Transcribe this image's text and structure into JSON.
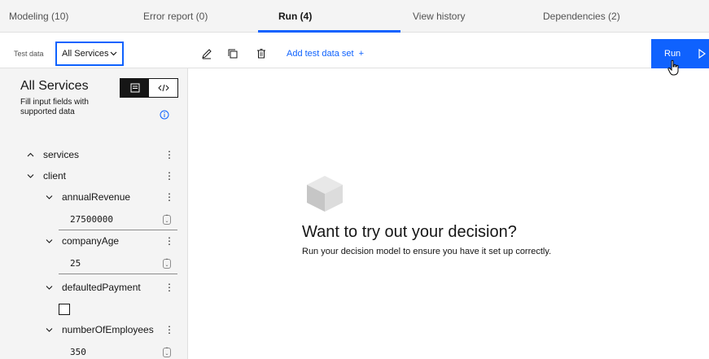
{
  "tabs": [
    {
      "label": "Modeling (10)"
    },
    {
      "label": "Error report (0)"
    },
    {
      "label": "Run (4)"
    },
    {
      "label": "View history"
    },
    {
      "label": "Dependencies (2)"
    }
  ],
  "active_tab": "Run (4)",
  "toolbar": {
    "test_data_label": "Test data",
    "test_data_selected": "All Services",
    "add_label": "Add test data set",
    "add_symbol": "+",
    "run_label": "Run"
  },
  "panel": {
    "title": "All Services",
    "subtitle": "Fill input fields with supported data",
    "tree": [
      {
        "label": "services",
        "expanded": false
      },
      {
        "label": "client",
        "expanded": true
      },
      {
        "label": "annualRevenue",
        "expanded": true,
        "value": "27500000"
      },
      {
        "label": "companyAge",
        "expanded": true,
        "value": "25"
      },
      {
        "label": "defaultedPayment",
        "expanded": true,
        "checked": false
      },
      {
        "label": "numberOfEmployees",
        "expanded": true,
        "value": "350"
      }
    ]
  },
  "empty_state": {
    "title": "Want to try out your decision?",
    "subtitle": "Run your decision model to ensure you have it set up correctly."
  },
  "colors": {
    "accent": "#0f62fe",
    "panel_bg": "#f4f4f4",
    "text": "#161616"
  },
  "icons": {
    "edit": "edit-icon",
    "copy": "copy-icon",
    "delete": "trash-icon",
    "run": "play-icon",
    "info": "info-icon",
    "form_view": "form-view-icon",
    "code_view": "code-view-icon",
    "empty": "cube-icon"
  }
}
